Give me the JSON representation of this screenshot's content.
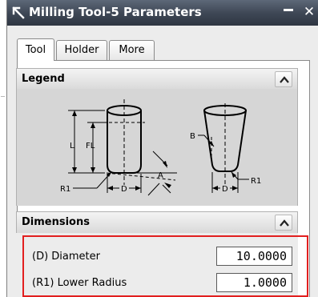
{
  "window": {
    "title": "Milling Tool-5 Parameters",
    "title_icon": "arrow-cursor-icon",
    "minimize_icon": "minimize-icon",
    "close_icon": "close-icon",
    "close_glyph": "✕"
  },
  "tabs": [
    {
      "label": "Tool",
      "active": true
    },
    {
      "label": "Holder",
      "active": false
    },
    {
      "label": "More",
      "active": false
    }
  ],
  "legend": {
    "header": "Legend",
    "collapse_icon": "chevron-up-icon",
    "diagram_labels": {
      "length": "L",
      "flute_length": "FL",
      "lower_radius_left": "R1",
      "diameter_left": "D",
      "tip_angle": "A",
      "taper_angle": "B",
      "lower_radius_right": "R1",
      "diameter_right": "D"
    }
  },
  "dimensions": {
    "header": "Dimensions",
    "collapse_icon": "chevron-up-icon",
    "params": [
      {
        "label": "(D) Diameter",
        "value": "10.0000"
      },
      {
        "label": "(R1) Lower Radius",
        "value": "1.0000"
      }
    ]
  },
  "colors": {
    "titlebar": "#3f4856",
    "highlight": "#e21f1f",
    "legend_bg": "#d6d6d6",
    "panel_bg": "#ececec"
  }
}
